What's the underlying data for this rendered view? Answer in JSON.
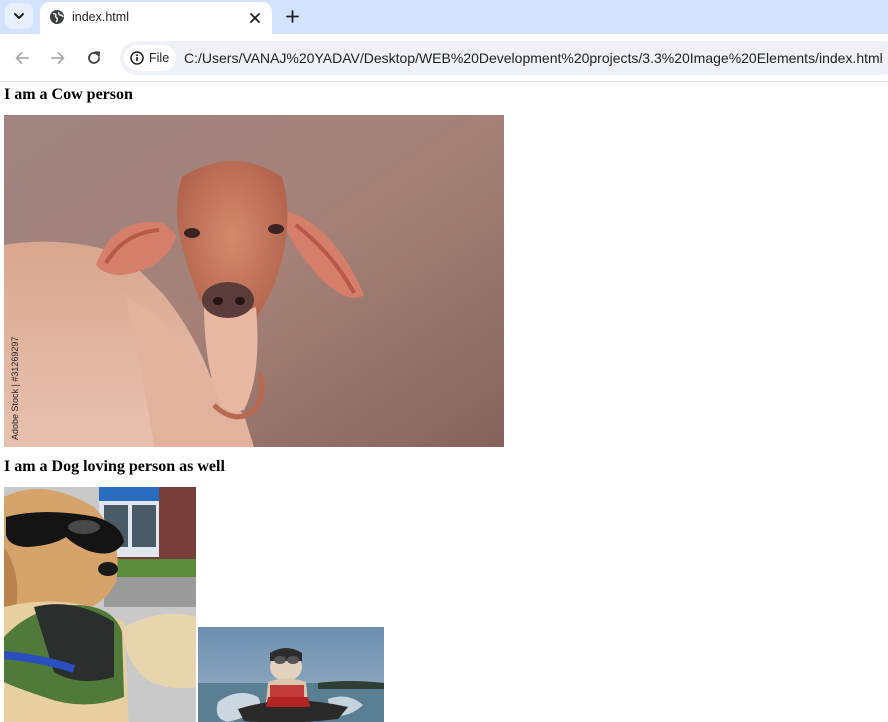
{
  "browser": {
    "tab": {
      "title": "index.html"
    },
    "site_info_label": "File",
    "url": "C:/Users/VANAJ%20YADAV/Desktop/WEB%20Development%20projects/3.3%20Image%20Elements/index.html"
  },
  "page": {
    "heading_1": "I am a Cow person",
    "heading_2": "I am a Dog loving person as well",
    "images": [
      {
        "name": "cow-image",
        "watermark": "Adobe Stock | #31269297"
      },
      {
        "name": "dog-sunglasses-image"
      },
      {
        "name": "dog-jetski-image"
      }
    ]
  },
  "icons": {
    "tab_menu": "chevron-down-icon",
    "favicon": "globe-icon",
    "tab_close": "close-icon",
    "new_tab": "plus-icon",
    "back": "arrow-left-icon",
    "forward": "arrow-right-icon",
    "reload": "reload-icon",
    "site_info": "info-icon"
  },
  "colors": {
    "tabstrip": "#d3e3fd",
    "omnibox": "#eef1f7",
    "toolbar": "#ffffff"
  }
}
